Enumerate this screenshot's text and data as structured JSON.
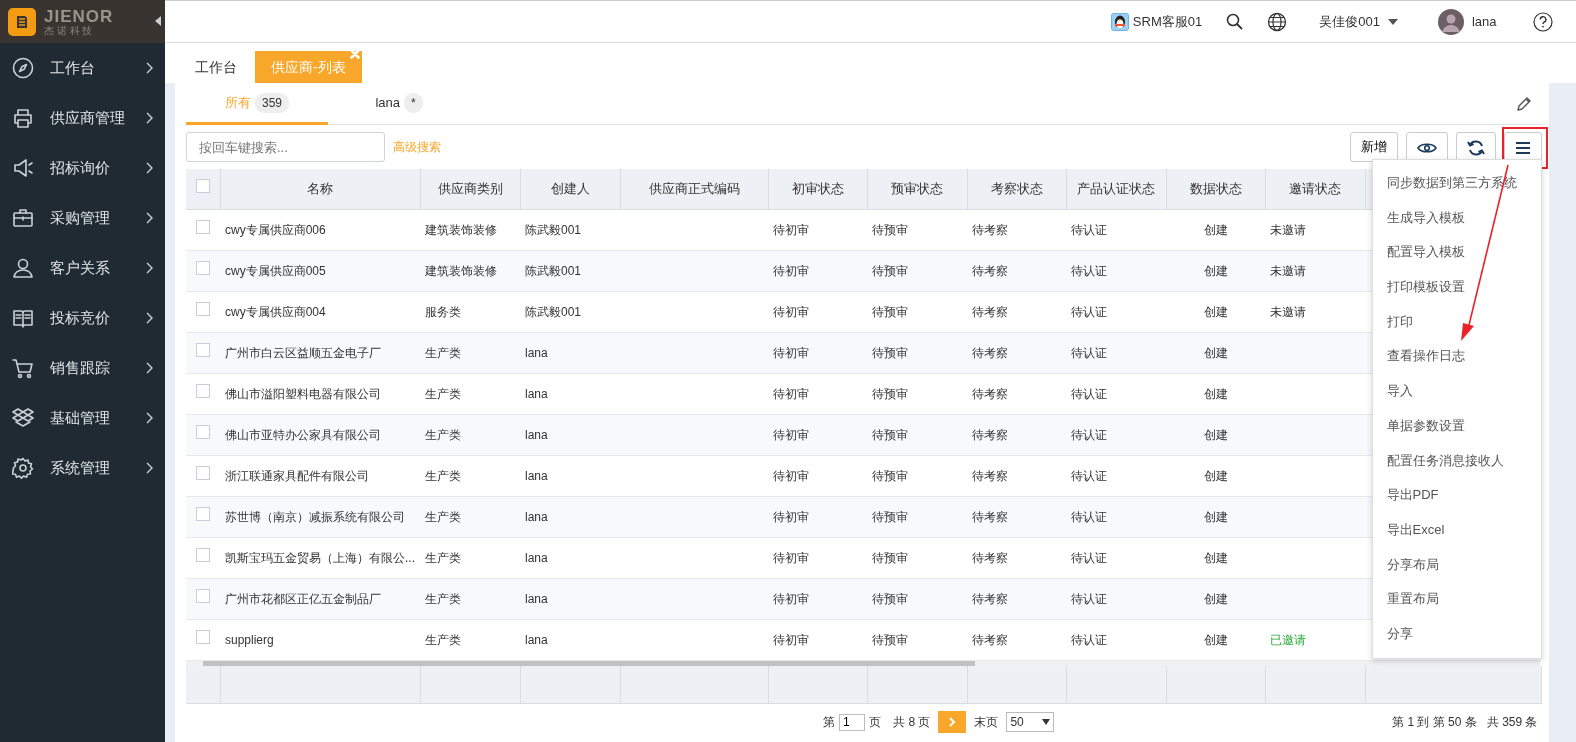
{
  "brand": {
    "name": "JIENOR",
    "subtitle": "杰 诺 科 技"
  },
  "sidebar": {
    "items": [
      {
        "label": "工作台"
      },
      {
        "label": "供应商管理"
      },
      {
        "label": "招标询价"
      },
      {
        "label": "采购管理"
      },
      {
        "label": "客户关系"
      },
      {
        "label": "投标竞价"
      },
      {
        "label": "销售跟踪"
      },
      {
        "label": "基础管理"
      },
      {
        "label": "系统管理"
      }
    ]
  },
  "header": {
    "service": "SRM客服01",
    "company": "吴佳俊001",
    "user": "lana"
  },
  "tabs": [
    {
      "label": "工作台",
      "selected": false
    },
    {
      "label": "供应商-列表",
      "selected": true,
      "closable": true
    }
  ],
  "views": [
    {
      "label": "所有",
      "badge": "359",
      "selected": true
    },
    {
      "label": "lana",
      "badge": "*",
      "selected": false
    }
  ],
  "toolbar": {
    "search": {
      "placeholder": "按回车键搜索..."
    },
    "advanced": "高级搜索",
    "add": "新增"
  },
  "table": {
    "header_checked": false,
    "columns": [
      "名称",
      "供应商类别",
      "创建人",
      "供应商正式编码",
      "初审状态",
      "预审状态",
      "考察状态",
      "产品认证状态",
      "数据状态",
      "邀请状态"
    ],
    "rows": [
      {
        "checked": false,
        "cells": [
          "cwy专属供应商006",
          "建筑装饰装修",
          "陈武毅001",
          "",
          "待初审",
          "待预审",
          "待考察",
          "待认证",
          "创建"
        ],
        "invite_status": {
          "text": "未邀请",
          "invited": false
        }
      },
      {
        "checked": false,
        "cells": [
          "cwy专属供应商005",
          "建筑装饰装修",
          "陈武毅001",
          "",
          "待初审",
          "待预审",
          "待考察",
          "待认证",
          "创建"
        ],
        "invite_status": {
          "text": "未邀请",
          "invited": false
        }
      },
      {
        "checked": false,
        "cells": [
          "cwy专属供应商004",
          "服务类",
          "陈武毅001",
          "",
          "待初审",
          "待预审",
          "待考察",
          "待认证",
          "创建"
        ],
        "invite_status": {
          "text": "未邀请",
          "invited": false
        }
      },
      {
        "checked": false,
        "cells": [
          "广州市白云区益顺五金电子厂",
          "生产类",
          "lana",
          "",
          "待初审",
          "待预审",
          "待考察",
          "待认证",
          "创建"
        ]
      },
      {
        "checked": false,
        "cells": [
          "佛山市溢阳塑料电器有限公司",
          "生产类",
          "lana",
          "",
          "待初审",
          "待预审",
          "待考察",
          "待认证",
          "创建"
        ]
      },
      {
        "checked": false,
        "cells": [
          "佛山市亚特办公家具有限公司",
          "生产类",
          "lana",
          "",
          "待初审",
          "待预审",
          "待考察",
          "待认证",
          "创建"
        ]
      },
      {
        "checked": false,
        "cells": [
          "浙江联通家具配件有限公司",
          "生产类",
          "lana",
          "",
          "待初审",
          "待预审",
          "待考察",
          "待认证",
          "创建"
        ]
      },
      {
        "checked": false,
        "cells": [
          "苏世博（南京）减振系统有限公司",
          "生产类",
          "lana",
          "",
          "待初审",
          "待预审",
          "待考察",
          "待认证",
          "创建"
        ]
      },
      {
        "checked": false,
        "cells": [
          "凯斯宝玛五金贸易（上海）有限公...",
          "生产类",
          "lana",
          "",
          "待初审",
          "待预审",
          "待考察",
          "待认证",
          "创建"
        ]
      },
      {
        "checked": false,
        "cells": [
          "广州市花都区正亿五金制品厂",
          "生产类",
          "lana",
          "",
          "待初审",
          "待预审",
          "待考察",
          "待认证",
          "创建"
        ]
      },
      {
        "checked": false,
        "cells": [
          "supplierg",
          "生产类",
          "lana",
          "",
          "待初审",
          "待预审",
          "待考察",
          "待认证",
          "创建"
        ],
        "invite_status": {
          "text": "已邀请",
          "invited": true
        }
      }
    ]
  },
  "menu": {
    "items": [
      "同步数据到第三方系统",
      "生成导入模板",
      "配置导入模板",
      "打印模板设置",
      "打印",
      "查看操作日志",
      "导入",
      "单据参数设置",
      "配置任务消息接收人",
      "导出PDF",
      "导出Excel",
      "分享布局",
      "重置布局",
      "分享"
    ]
  },
  "pagination": {
    "page_prefix": "第",
    "page": "1",
    "page_suffix": "页",
    "total_pages": "共 8 页",
    "last": "末页",
    "page_size": "50",
    "summary": "第 1 到 第 50 条   共 359 条"
  }
}
